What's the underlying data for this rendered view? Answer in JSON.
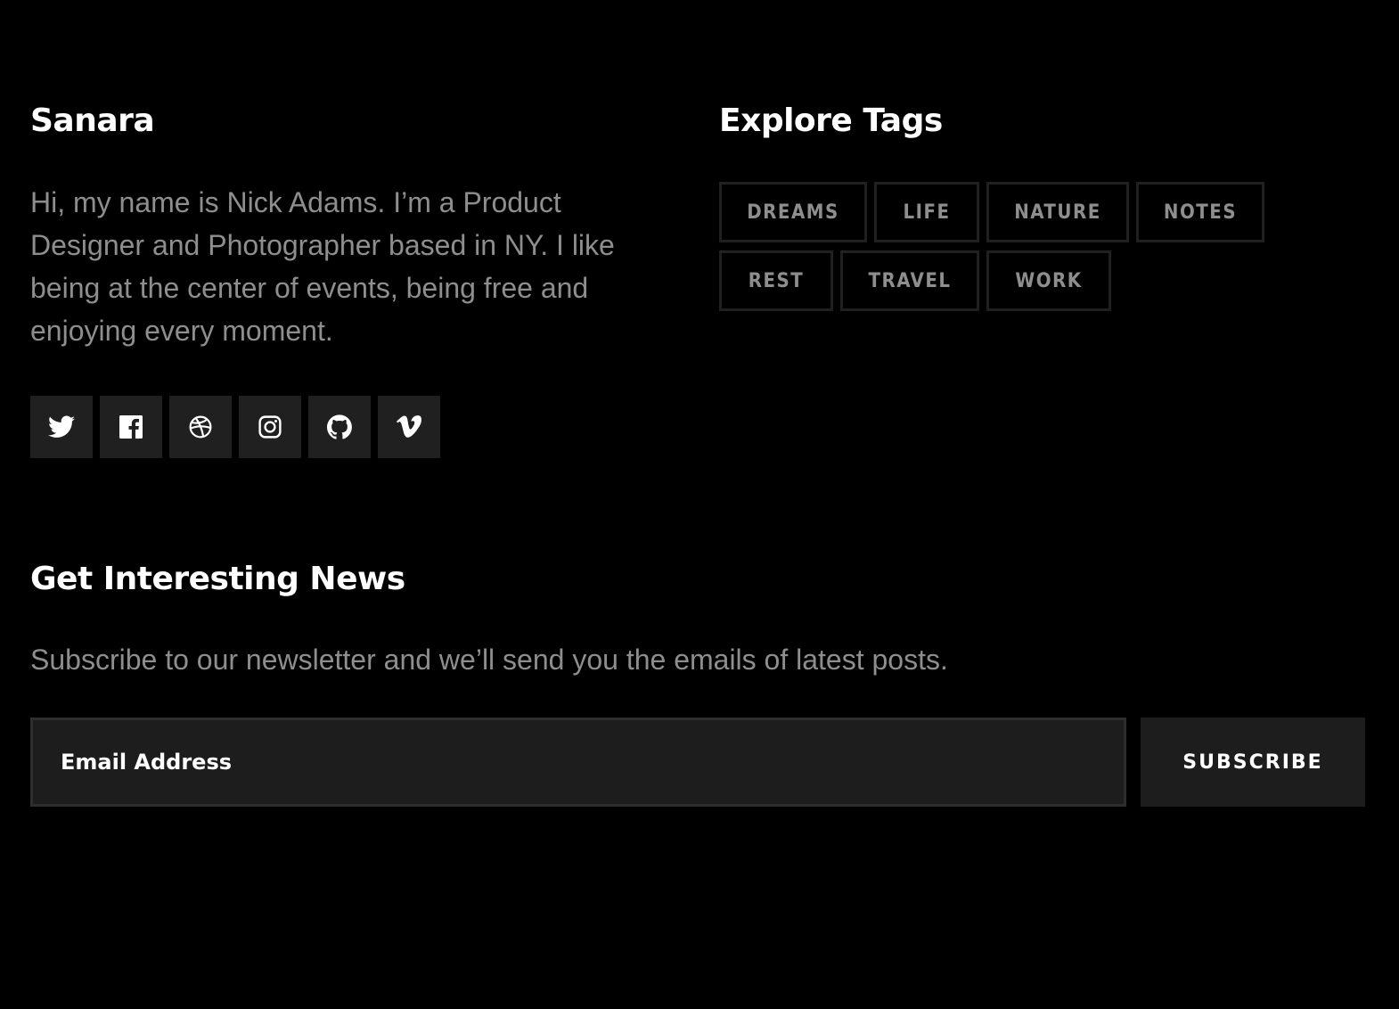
{
  "about": {
    "title": "Sanara",
    "bio": "Hi, my name is Nick Adams. I’m a Product Designer and Photographer based in NY. I like being at the center of events, being free and enjoying every moment."
  },
  "social": [
    {
      "icon": "twitter-icon"
    },
    {
      "icon": "facebook-icon"
    },
    {
      "icon": "dribbble-icon"
    },
    {
      "icon": "instagram-icon"
    },
    {
      "icon": "github-icon"
    },
    {
      "icon": "vimeo-icon"
    }
  ],
  "tags": {
    "title": "Explore Tags",
    "items": [
      "DREAMS",
      "LIFE",
      "NATURE",
      "NOTES",
      "REST",
      "TRAVEL",
      "WORK"
    ]
  },
  "newsletter": {
    "title": "Get Interesting News",
    "text": "Subscribe to our newsletter and we’ll send you the emails of latest posts.",
    "email_placeholder": "Email Address",
    "button_label": "SUBSCRIBE"
  },
  "colors": {
    "background": "#000000",
    "heading": "#ffffff",
    "muted_text": "#8e8e8e",
    "button_bg": "#202020",
    "tag_border": "#202020"
  }
}
